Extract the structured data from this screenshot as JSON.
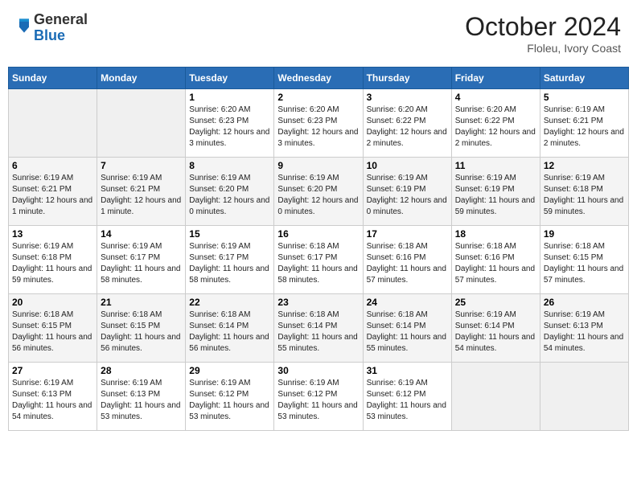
{
  "header": {
    "logo_general": "General",
    "logo_blue": "Blue",
    "month_title": "October 2024",
    "location": "Floleu, Ivory Coast"
  },
  "weekdays": [
    "Sunday",
    "Monday",
    "Tuesday",
    "Wednesday",
    "Thursday",
    "Friday",
    "Saturday"
  ],
  "weeks": [
    [
      {
        "day": "",
        "detail": ""
      },
      {
        "day": "",
        "detail": ""
      },
      {
        "day": "1",
        "detail": "Sunrise: 6:20 AM\nSunset: 6:23 PM\nDaylight: 12 hours and 3 minutes."
      },
      {
        "day": "2",
        "detail": "Sunrise: 6:20 AM\nSunset: 6:23 PM\nDaylight: 12 hours and 3 minutes."
      },
      {
        "day": "3",
        "detail": "Sunrise: 6:20 AM\nSunset: 6:22 PM\nDaylight: 12 hours and 2 minutes."
      },
      {
        "day": "4",
        "detail": "Sunrise: 6:20 AM\nSunset: 6:22 PM\nDaylight: 12 hours and 2 minutes."
      },
      {
        "day": "5",
        "detail": "Sunrise: 6:19 AM\nSunset: 6:21 PM\nDaylight: 12 hours and 2 minutes."
      }
    ],
    [
      {
        "day": "6",
        "detail": "Sunrise: 6:19 AM\nSunset: 6:21 PM\nDaylight: 12 hours and 1 minute."
      },
      {
        "day": "7",
        "detail": "Sunrise: 6:19 AM\nSunset: 6:21 PM\nDaylight: 12 hours and 1 minute."
      },
      {
        "day": "8",
        "detail": "Sunrise: 6:19 AM\nSunset: 6:20 PM\nDaylight: 12 hours and 0 minutes."
      },
      {
        "day": "9",
        "detail": "Sunrise: 6:19 AM\nSunset: 6:20 PM\nDaylight: 12 hours and 0 minutes."
      },
      {
        "day": "10",
        "detail": "Sunrise: 6:19 AM\nSunset: 6:19 PM\nDaylight: 12 hours and 0 minutes."
      },
      {
        "day": "11",
        "detail": "Sunrise: 6:19 AM\nSunset: 6:19 PM\nDaylight: 11 hours and 59 minutes."
      },
      {
        "day": "12",
        "detail": "Sunrise: 6:19 AM\nSunset: 6:18 PM\nDaylight: 11 hours and 59 minutes."
      }
    ],
    [
      {
        "day": "13",
        "detail": "Sunrise: 6:19 AM\nSunset: 6:18 PM\nDaylight: 11 hours and 59 minutes."
      },
      {
        "day": "14",
        "detail": "Sunrise: 6:19 AM\nSunset: 6:17 PM\nDaylight: 11 hours and 58 minutes."
      },
      {
        "day": "15",
        "detail": "Sunrise: 6:19 AM\nSunset: 6:17 PM\nDaylight: 11 hours and 58 minutes."
      },
      {
        "day": "16",
        "detail": "Sunrise: 6:18 AM\nSunset: 6:17 PM\nDaylight: 11 hours and 58 minutes."
      },
      {
        "day": "17",
        "detail": "Sunrise: 6:18 AM\nSunset: 6:16 PM\nDaylight: 11 hours and 57 minutes."
      },
      {
        "day": "18",
        "detail": "Sunrise: 6:18 AM\nSunset: 6:16 PM\nDaylight: 11 hours and 57 minutes."
      },
      {
        "day": "19",
        "detail": "Sunrise: 6:18 AM\nSunset: 6:15 PM\nDaylight: 11 hours and 57 minutes."
      }
    ],
    [
      {
        "day": "20",
        "detail": "Sunrise: 6:18 AM\nSunset: 6:15 PM\nDaylight: 11 hours and 56 minutes."
      },
      {
        "day": "21",
        "detail": "Sunrise: 6:18 AM\nSunset: 6:15 PM\nDaylight: 11 hours and 56 minutes."
      },
      {
        "day": "22",
        "detail": "Sunrise: 6:18 AM\nSunset: 6:14 PM\nDaylight: 11 hours and 56 minutes."
      },
      {
        "day": "23",
        "detail": "Sunrise: 6:18 AM\nSunset: 6:14 PM\nDaylight: 11 hours and 55 minutes."
      },
      {
        "day": "24",
        "detail": "Sunrise: 6:18 AM\nSunset: 6:14 PM\nDaylight: 11 hours and 55 minutes."
      },
      {
        "day": "25",
        "detail": "Sunrise: 6:19 AM\nSunset: 6:14 PM\nDaylight: 11 hours and 54 minutes."
      },
      {
        "day": "26",
        "detail": "Sunrise: 6:19 AM\nSunset: 6:13 PM\nDaylight: 11 hours and 54 minutes."
      }
    ],
    [
      {
        "day": "27",
        "detail": "Sunrise: 6:19 AM\nSunset: 6:13 PM\nDaylight: 11 hours and 54 minutes."
      },
      {
        "day": "28",
        "detail": "Sunrise: 6:19 AM\nSunset: 6:13 PM\nDaylight: 11 hours and 53 minutes."
      },
      {
        "day": "29",
        "detail": "Sunrise: 6:19 AM\nSunset: 6:12 PM\nDaylight: 11 hours and 53 minutes."
      },
      {
        "day": "30",
        "detail": "Sunrise: 6:19 AM\nSunset: 6:12 PM\nDaylight: 11 hours and 53 minutes."
      },
      {
        "day": "31",
        "detail": "Sunrise: 6:19 AM\nSunset: 6:12 PM\nDaylight: 11 hours and 53 minutes."
      },
      {
        "day": "",
        "detail": ""
      },
      {
        "day": "",
        "detail": ""
      }
    ]
  ]
}
